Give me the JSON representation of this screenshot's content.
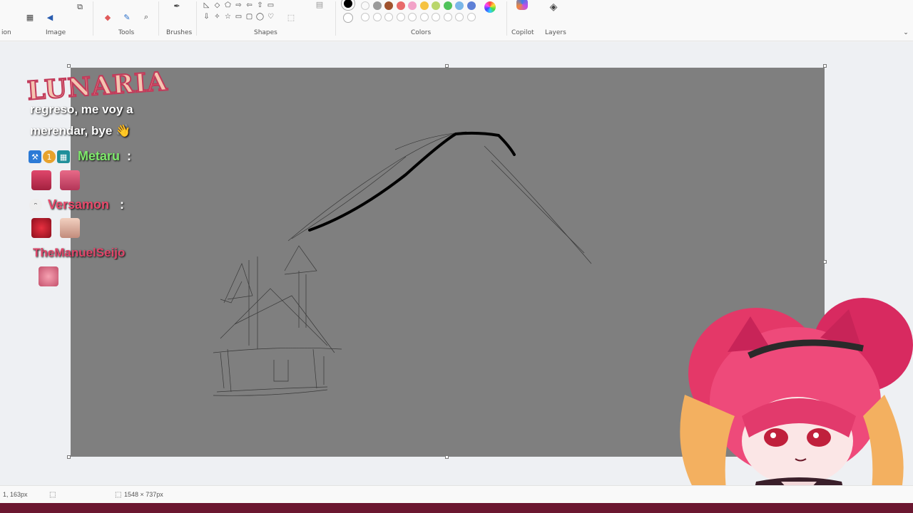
{
  "ribbon": {
    "groups": [
      {
        "label": "Image"
      },
      {
        "label": "Tools"
      },
      {
        "label": "Brushes"
      },
      {
        "label": "Shapes"
      },
      {
        "label": "Colors"
      },
      {
        "label": "Copilot"
      },
      {
        "label": "Layers"
      }
    ],
    "partial_left_label": "ion"
  },
  "palette": {
    "colors": [
      "#ffffff",
      "#9a9a9a",
      "#a0522d",
      "#e86a6a",
      "#f2a2c8",
      "#f5c242",
      "#b9d66b",
      "#4fc25a",
      "#7ab7e8",
      "#5d7fd6",
      "#9d7ad6"
    ]
  },
  "overlay": {
    "streamer_logo": "LUNARIA",
    "chat": [
      {
        "text": "regreso, me voy a"
      },
      {
        "text": "merendar, bye 👋"
      }
    ],
    "users": [
      {
        "name": "Metaru",
        "suffix": ":",
        "color": "#7ee86b"
      },
      {
        "name": "Versamon",
        "suffix": ":",
        "color": "#e84a6b"
      },
      {
        "name": "TheManuelSeijo",
        "suffix": "",
        "color": "#e0466a"
      }
    ]
  },
  "status": {
    "cursor_position": "1, 163px",
    "canvas_size": "1548 × 737px"
  }
}
